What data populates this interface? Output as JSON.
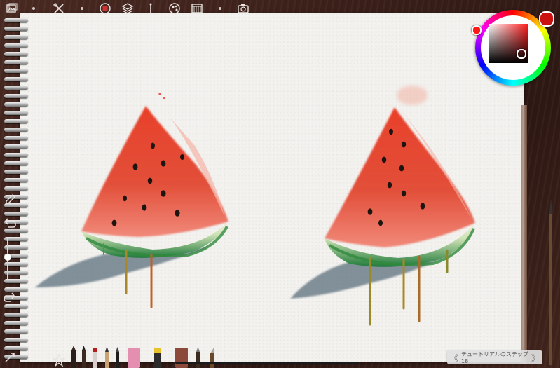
{
  "toolbar": {
    "icons": [
      "gallery-icon",
      "tools-icon",
      "layer-record-icon",
      "layers-icon",
      "brush-size-icon",
      "color-adjust-icon",
      "canvas-icon",
      "camera-icon"
    ]
  },
  "color_picker": {
    "current_color": "#cc1111",
    "hue": "#ff1a1a"
  },
  "tutorial": {
    "label": "チュートリアルのステップ 18",
    "prev_symbol": "《",
    "next_symbol": "》"
  },
  "artwork": {
    "subject": "watermelon-slices"
  }
}
